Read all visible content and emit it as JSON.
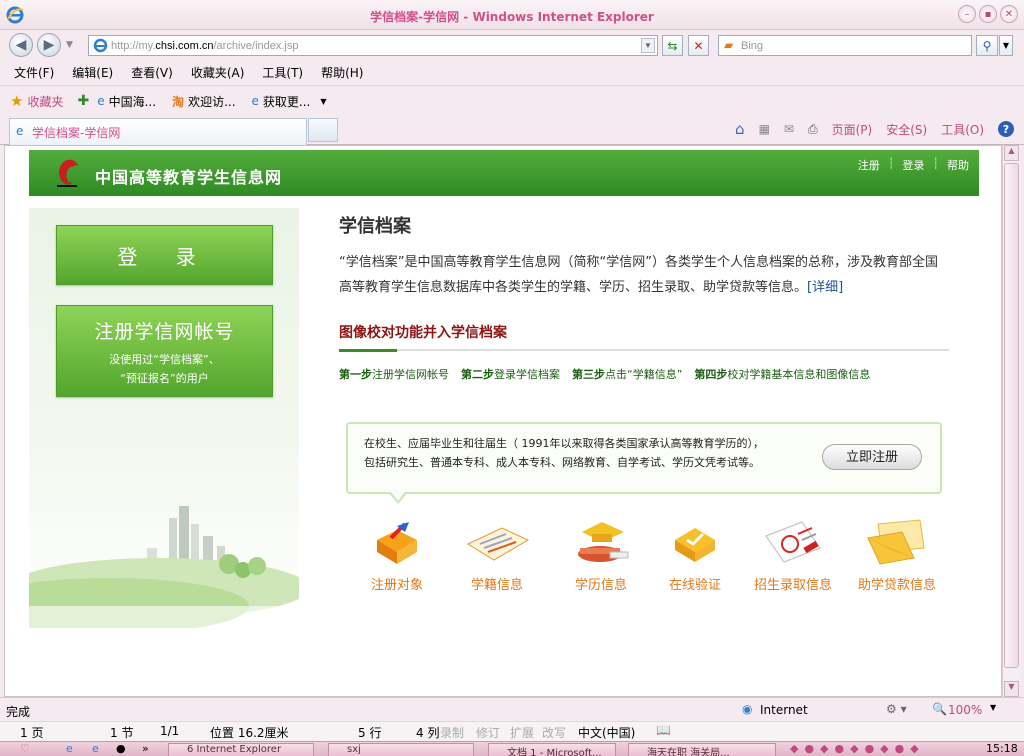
{
  "window": {
    "title": "学信档案-学信网 - Windows Internet Explorer"
  },
  "address": {
    "prefix": "http://my.",
    "host": "chsi.com.cn",
    "path": "/archive/index.jsp"
  },
  "search": {
    "placeholder": "Bing"
  },
  "menu": [
    "文件(F)",
    "编辑(E)",
    "查看(V)",
    "收藏夹(A)",
    "工具(T)",
    "帮助(H)"
  ],
  "favorites": {
    "label": "收藏夹",
    "items": [
      "中国海...",
      "欢迎访...",
      "获取更..."
    ]
  },
  "tab": {
    "label": "学信档案-学信网"
  },
  "commands": [
    "页面(P)",
    "安全(S)",
    "工具(O)"
  ],
  "site": {
    "name": "中国高等教育学生信息网",
    "links": [
      "注册",
      "登录",
      "帮助"
    ]
  },
  "sidebar": {
    "login": "登 录",
    "register_title": "注册学信网帐号",
    "register_sub1": "没使用过“学信档案”、",
    "register_sub2": "“预征报名”的用户"
  },
  "main": {
    "title": "学信档案",
    "intro": "“学信档案”是中国高等教育学生信息网（简称“学信网”）各类学生个人信息档案的总称，涉及教育部全国高等教育学生信息数据库中各类学生的学籍、学历、招生录取、助学贷款等信息。",
    "detail_link": "[详细]",
    "subhead": "图像校对功能并入学信档案",
    "steps": [
      {
        "label": "第一步",
        "text": "注册学信网帐号"
      },
      {
        "label": "第二步",
        "text": "登录学信档案"
      },
      {
        "label": "第三步",
        "text": "点击“学籍信息”"
      },
      {
        "label": "第四步",
        "text": "校对学籍基本信息和图像信息"
      }
    ],
    "notice_line1": "在校生、应届毕业生和往届生（ 1991年以来取得各类国家承认高等教育学历的），",
    "notice_line2": "包括研究生、普通本专科、成人本专科、网络教育、自学考试、学历文凭考试等。",
    "signup_button": "立即注册",
    "icons": [
      "注册对象",
      "学籍信息",
      "学历信息",
      "在线验证",
      "招生录取信息",
      "助学贷款信息"
    ]
  },
  "status": {
    "text": "完成",
    "zone": "Internet",
    "zoom": "100%"
  },
  "wordbar": {
    "page": "1 页",
    "section": "1 节",
    "count": "1/1",
    "position": "位置 16.2厘米",
    "row": "5 行",
    "col": "4 列",
    "lang": "中文(中国)",
    "modes": [
      "录制",
      "修订",
      "扩展",
      "改写"
    ]
  },
  "taskbar": {
    "items": [
      "6 Internet Explorer",
      "sxj",
      "文档 1 - Microsoft...",
      "海天在职 海关局..."
    ],
    "clock": "15:18"
  },
  "colors": {
    "header_green": "#3a9a2b",
    "button_green": "#6cbf3e",
    "accent_orange": "#e1781b",
    "title_pink": "#d0508a"
  }
}
